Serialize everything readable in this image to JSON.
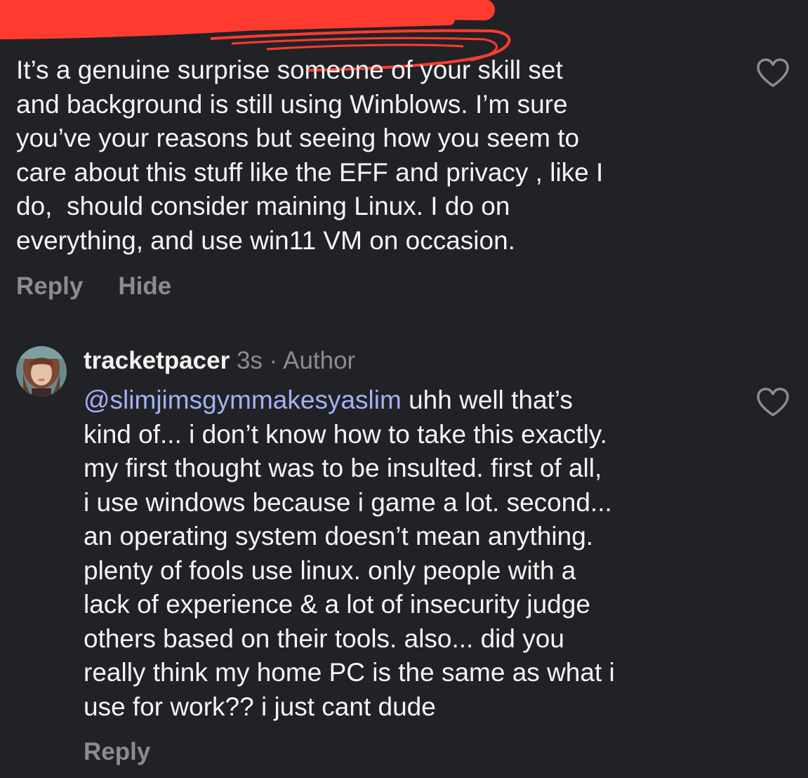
{
  "comments": [
    {
      "text_lines": [
        "It’s a genuine surprise someone of your skill set",
        "and background is still using Winblows. I’m sure",
        "you’ve your reasons but seeing how you seem to",
        "care about this stuff like the EFF and privacy , like I",
        "do,  should consider maining Linux. I do on",
        "everything, and use win11 VM on occasion."
      ],
      "actions": {
        "reply": "Reply",
        "hide": "Hide"
      },
      "like_icon": "heart-icon"
    },
    {
      "username": "tracketpacer",
      "time": "3s",
      "separator": "·",
      "badge": "Author",
      "avatar_icon": "avatar",
      "mention": "@slimjimsgymmakesyaslim",
      "first_line_rest": " uhh well that’s",
      "text_lines": [
        "kind of... i don’t know how to take this exactly.",
        "my first thought was to be insulted. first of all,",
        "i use windows because i game a lot. second...",
        "an operating system doesn’t mean anything.",
        "plenty of fools use linux. only people with a",
        "lack of experience & a lot of insecurity judge",
        "others based on their tools. also... did you",
        "really think my home PC is the same as what i",
        "use for work?? i just cant dude"
      ],
      "actions": {
        "reply": "Reply"
      },
      "like_icon": "heart-icon"
    }
  ],
  "colors": {
    "background": "#212226",
    "text": "#f5f5f5",
    "muted": "#8b8c91",
    "mention": "#a6b0f5",
    "redaction": "#ff3b30"
  }
}
